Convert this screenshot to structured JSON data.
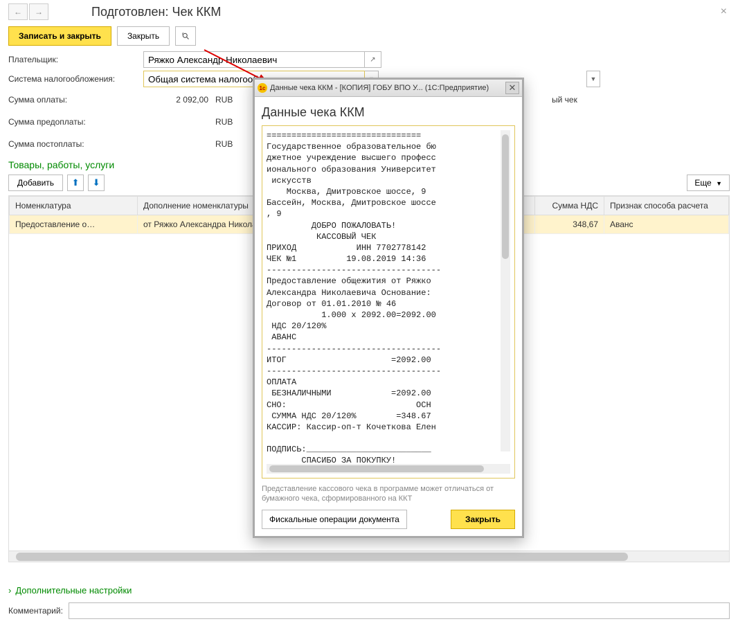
{
  "header": {
    "title": "Подготовлен: Чек ККМ"
  },
  "toolbar": {
    "save_close": "Записать и закрыть",
    "close": "Закрыть"
  },
  "form": {
    "payer_label": "Плательщик:",
    "payer_value": "Ряжко Александр Николаевич",
    "tax_label": "Система налогообложения:",
    "tax_value": "Общая система налогооблож",
    "sum_pay_label": "Сумма оплаты:",
    "sum_pay_value": "2 092,00",
    "sum_pre_label": "Сумма предоплаты:",
    "sum_pre_value": "",
    "sum_post_label": "Сумма постоплаты:",
    "sum_post_value": "",
    "currency": "RUB",
    "right_check": "ый чек"
  },
  "section": {
    "goods": "Товары, работы, услуги",
    "add": "Добавить",
    "more": "Еще"
  },
  "table": {
    "columns": [
      "Номенклатура",
      "Дополнение номенклатуры",
      "",
      "Сумма НДС",
      "Признак способа расчета"
    ],
    "rows": [
      {
        "nom": "Предоставление о…",
        "dop": "от Ряжко Александра Никола",
        "nds": "348,67",
        "sign": "Аванс"
      }
    ]
  },
  "bottom": {
    "expand": "Дополнительные настройки",
    "comment_label": "Комментарий:"
  },
  "modal": {
    "titlebar": "Данные чека ККМ - [КОПИЯ] ГОБУ ВПО У...  (1С:Предприятие)",
    "heading": "Данные чека ККМ",
    "receipt": "===============================\nГосударственное образовательное бю\nджетное учреждение высшего професс\nионального образования Университет\n искусств\n    Москва, Дмитровское шоссе, 9\nБассейн, Москва, Дмитровское шоссе\n, 9\n         ДОБРО ПОЖАЛОВАТЬ!\n          КАССОВЫЙ ЧЕК\nПРИХОД            ИНН 7702778142\nЧЕК №1          19.08.2019 14:36\n-----------------------------------\nПредоставление общежития от Ряжко \nАлександра Николаевича Основание: \nДоговор от 01.01.2010 № 46\n           1.000 x 2092.00=2092.00\n НДС 20/120%\n АВАНС\n-----------------------------------\nИТОГ                     =2092.00\n-----------------------------------\nОПЛАТА\n БЕЗНАЛИЧНЫМИ            =2092.00\nСНО:                          ОСН\n СУММА НДС 20/120%        =348.67\nКАССИР: Кассир-оп-т Кочеткова Елен\n\nПОДПИСЬ:_________________________\n       СПАСИБО ЗА ПОКУПКУ!",
    "disclaimer": "Представление кассового чека в программе может отличаться от бумажного чека, сформированного на ККТ",
    "fiscal": "Фискальные операции документа",
    "close": "Закрыть"
  }
}
